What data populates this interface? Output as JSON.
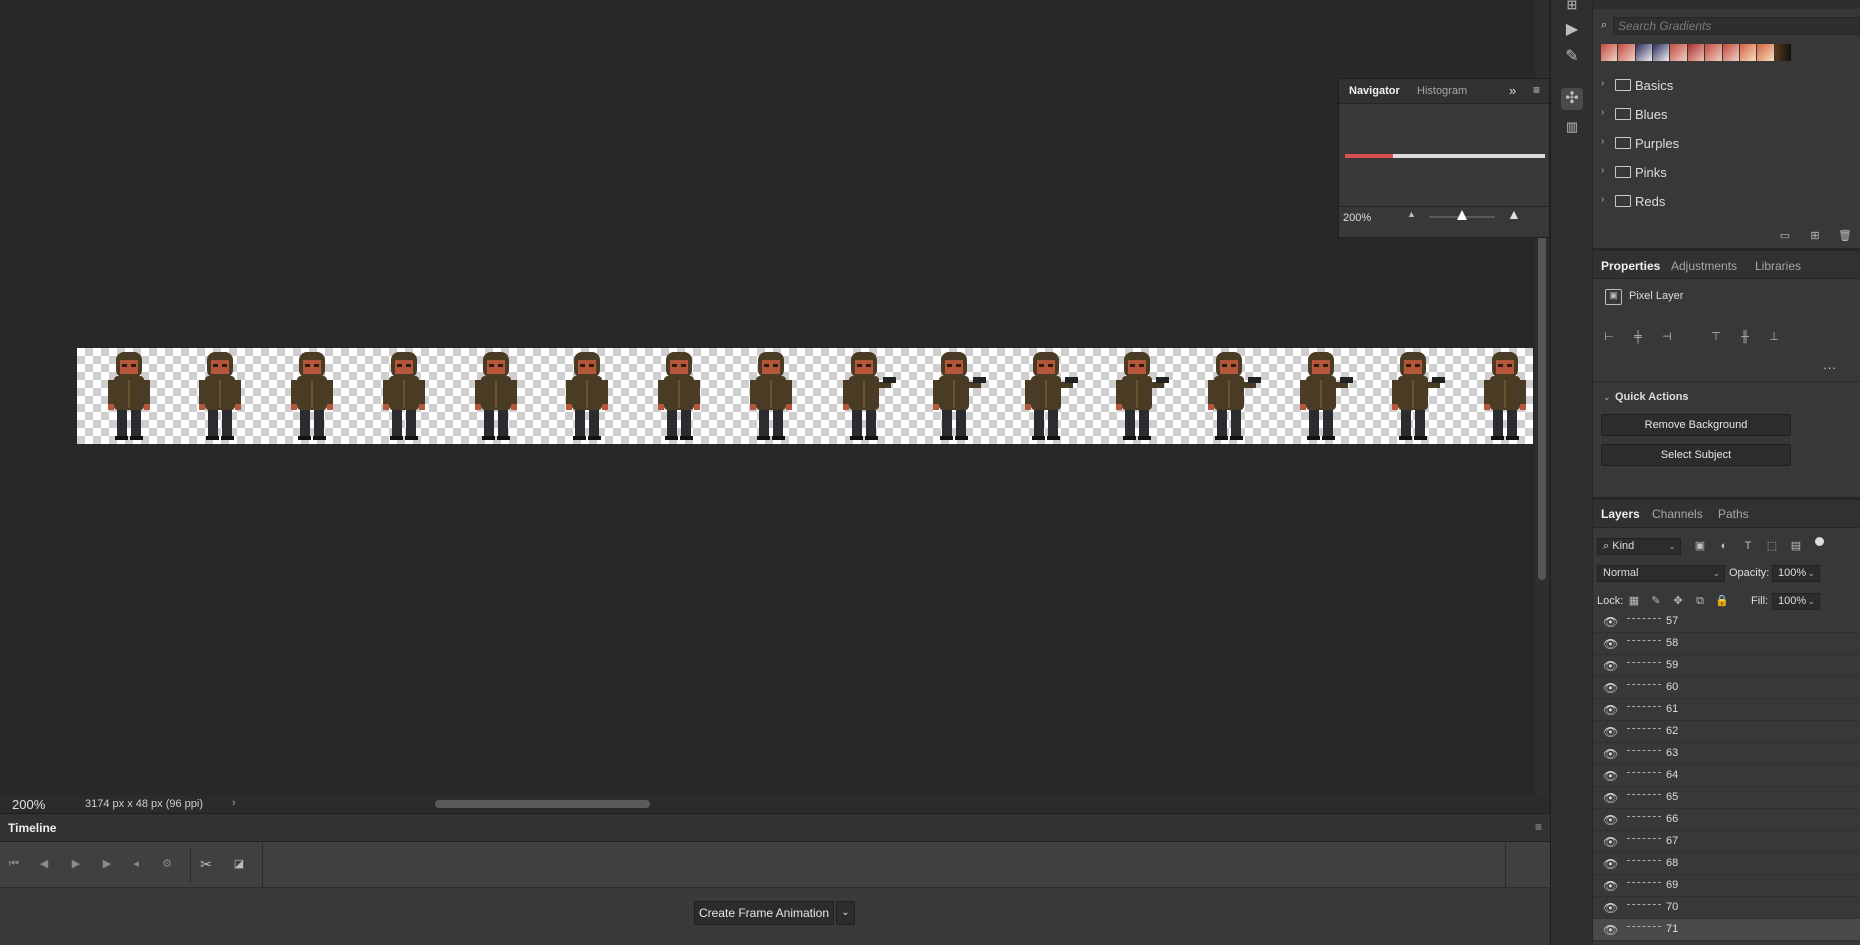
{
  "canvas": {
    "zoom": "200%",
    "doc_info": "3174 px x 48 px (96 ppi)"
  },
  "navigator": {
    "tabs": [
      "Navigator",
      "Histogram"
    ],
    "zoom": "200%"
  },
  "gradients": {
    "search_placeholder": "Search Gradients",
    "folders": [
      "Basics",
      "Blues",
      "Purples",
      "Pinks",
      "Reds"
    ]
  },
  "properties": {
    "tabs": [
      "Properties",
      "Adjustments",
      "Libraries"
    ],
    "layer_type": "Pixel Layer",
    "quick_actions_label": "Quick Actions",
    "remove_bg_label": "Remove Background",
    "select_subject_label": "Select Subject"
  },
  "layers": {
    "tabs": [
      "Layers",
      "Channels",
      "Paths"
    ],
    "filter_kind": "Kind",
    "blend_mode": "Normal",
    "opacity_label": "Opacity:",
    "opacity": "100%",
    "lock_label": "Lock:",
    "fill_label": "Fill:",
    "fill": "100%",
    "items": [
      "57",
      "58",
      "59",
      "60",
      "61",
      "62",
      "63",
      "64",
      "65",
      "66",
      "67",
      "68",
      "69",
      "70",
      "71"
    ]
  },
  "timeline": {
    "title": "Timeline",
    "create_label": "Create Frame Animation"
  },
  "colors": {
    "panel_bg": "#383838",
    "canvas_bg": "#282828",
    "hood_brown": "#4a3b24",
    "skin": "#b3563a"
  }
}
